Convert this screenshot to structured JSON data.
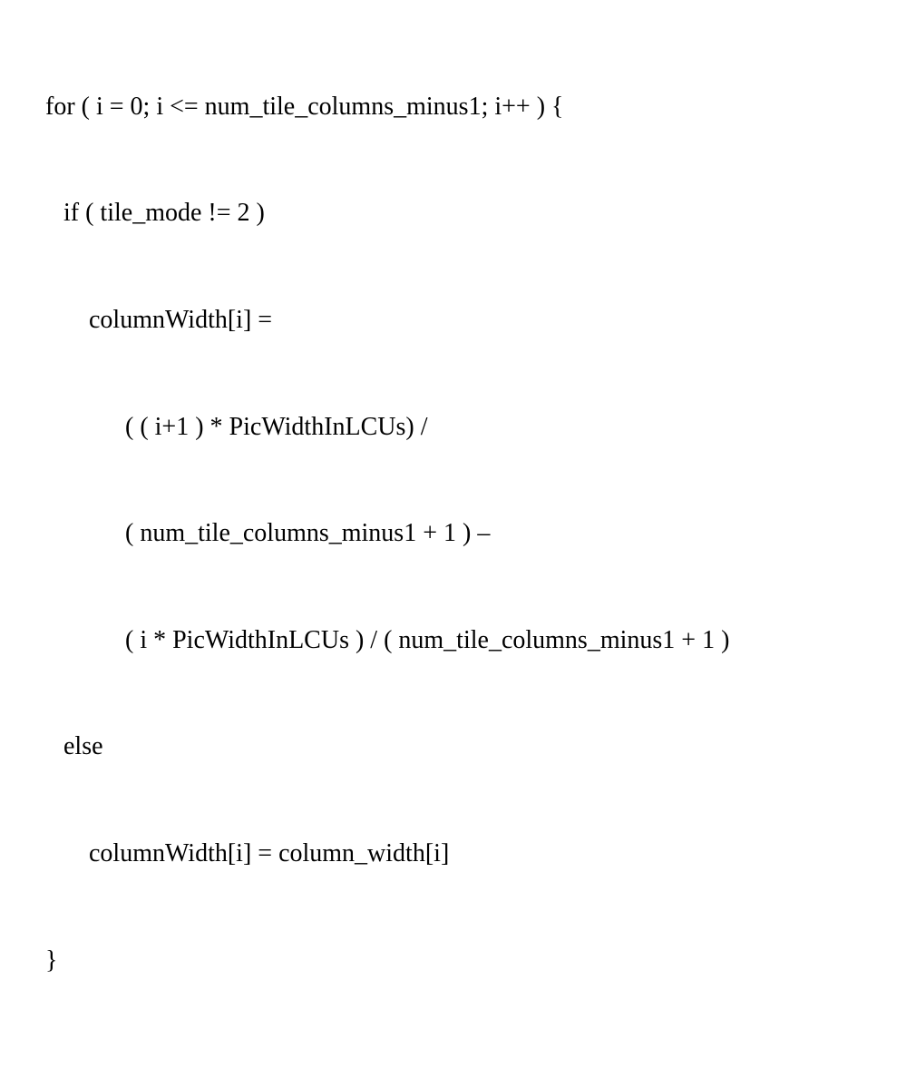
{
  "code": {
    "line1": "for ( i = 0; i <= num_tile_columns_minus1; i++ ) {",
    "line2": "if ( tile_mode != 2 )",
    "line3": "columnWidth[i] =",
    "line4": "( ( i+1 ) * PicWidthInLCUs) /",
    "line5": "( num_tile_columns_minus1 + 1 ) –",
    "line6": "( i * PicWidthInLCUs ) / ( num_tile_columns_minus1 + 1 )",
    "line7": "else",
    "line8": "columnWidth[i] = column_width[i]",
    "line9": "}"
  }
}
